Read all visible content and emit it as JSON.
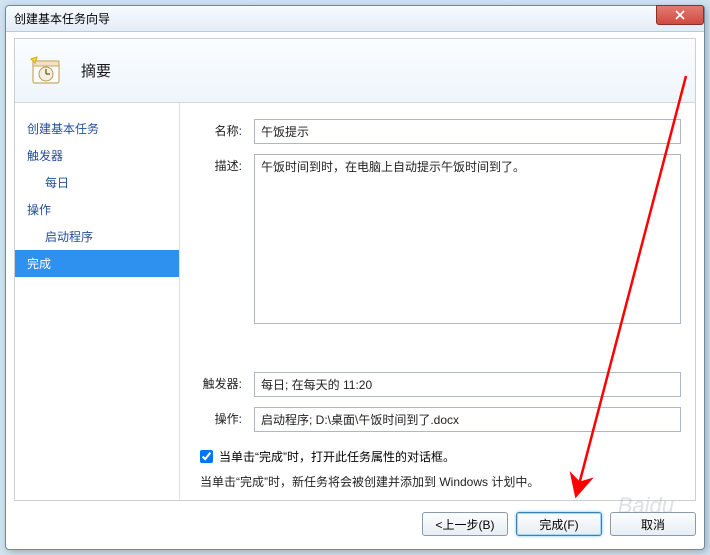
{
  "window": {
    "title": "创建基本任务向导"
  },
  "header": {
    "title": "摘要"
  },
  "sidebar": {
    "items": [
      {
        "label": "创建基本任务",
        "sub": false,
        "selected": false
      },
      {
        "label": "触发器",
        "sub": false,
        "selected": false
      },
      {
        "label": "每日",
        "sub": true,
        "selected": false
      },
      {
        "label": "操作",
        "sub": false,
        "selected": false
      },
      {
        "label": "启动程序",
        "sub": true,
        "selected": false
      },
      {
        "label": "完成",
        "sub": false,
        "selected": true
      }
    ]
  },
  "fields": {
    "name_label": "名称:",
    "name_value": "午饭提示",
    "desc_label": "描述:",
    "desc_value": "午饭时间到时，在电脑上自动提示午饭时间到了。",
    "trigger_label": "触发器:",
    "trigger_value": "每日; 在每天的 11:20",
    "action_label": "操作:",
    "action_value": "启动程序; D:\\桌面\\午饭时间到了.docx"
  },
  "options": {
    "open_props_label": "当单击“完成”时，打开此任务属性的对话框。",
    "info_text": "当单击“完成”时，新任务将会被创建并添加到 Windows 计划中。"
  },
  "buttons": {
    "back": "<上一步(B)",
    "finish": "完成(F)",
    "cancel": "取消"
  },
  "colors": {
    "selection": "#2e90ef",
    "link": "#1e4f9a",
    "arrow": "#ff0000"
  }
}
